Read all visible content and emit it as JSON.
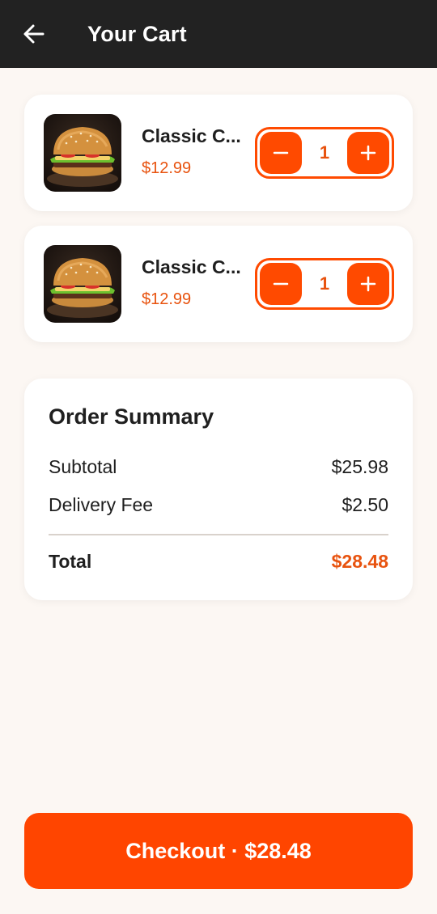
{
  "header": {
    "title": "Your Cart",
    "back_icon": "arrow-left-icon"
  },
  "cart": {
    "items": [
      {
        "name": "Classic C...",
        "price": "$12.99",
        "quantity": "1",
        "image": "burger-image"
      },
      {
        "name": "Classic C...",
        "price": "$12.99",
        "quantity": "1",
        "image": "burger-image"
      }
    ]
  },
  "summary": {
    "title": "Order Summary",
    "subtotal_label": "Subtotal",
    "subtotal_value": "$25.98",
    "delivery_label": "Delivery Fee",
    "delivery_value": "$2.50",
    "total_label": "Total",
    "total_value": "$28.48"
  },
  "checkout": {
    "label": "Checkout · $28.48"
  },
  "colors": {
    "accent": "#ff4500",
    "header_bg": "#222222",
    "page_bg": "#fcf7f3"
  }
}
